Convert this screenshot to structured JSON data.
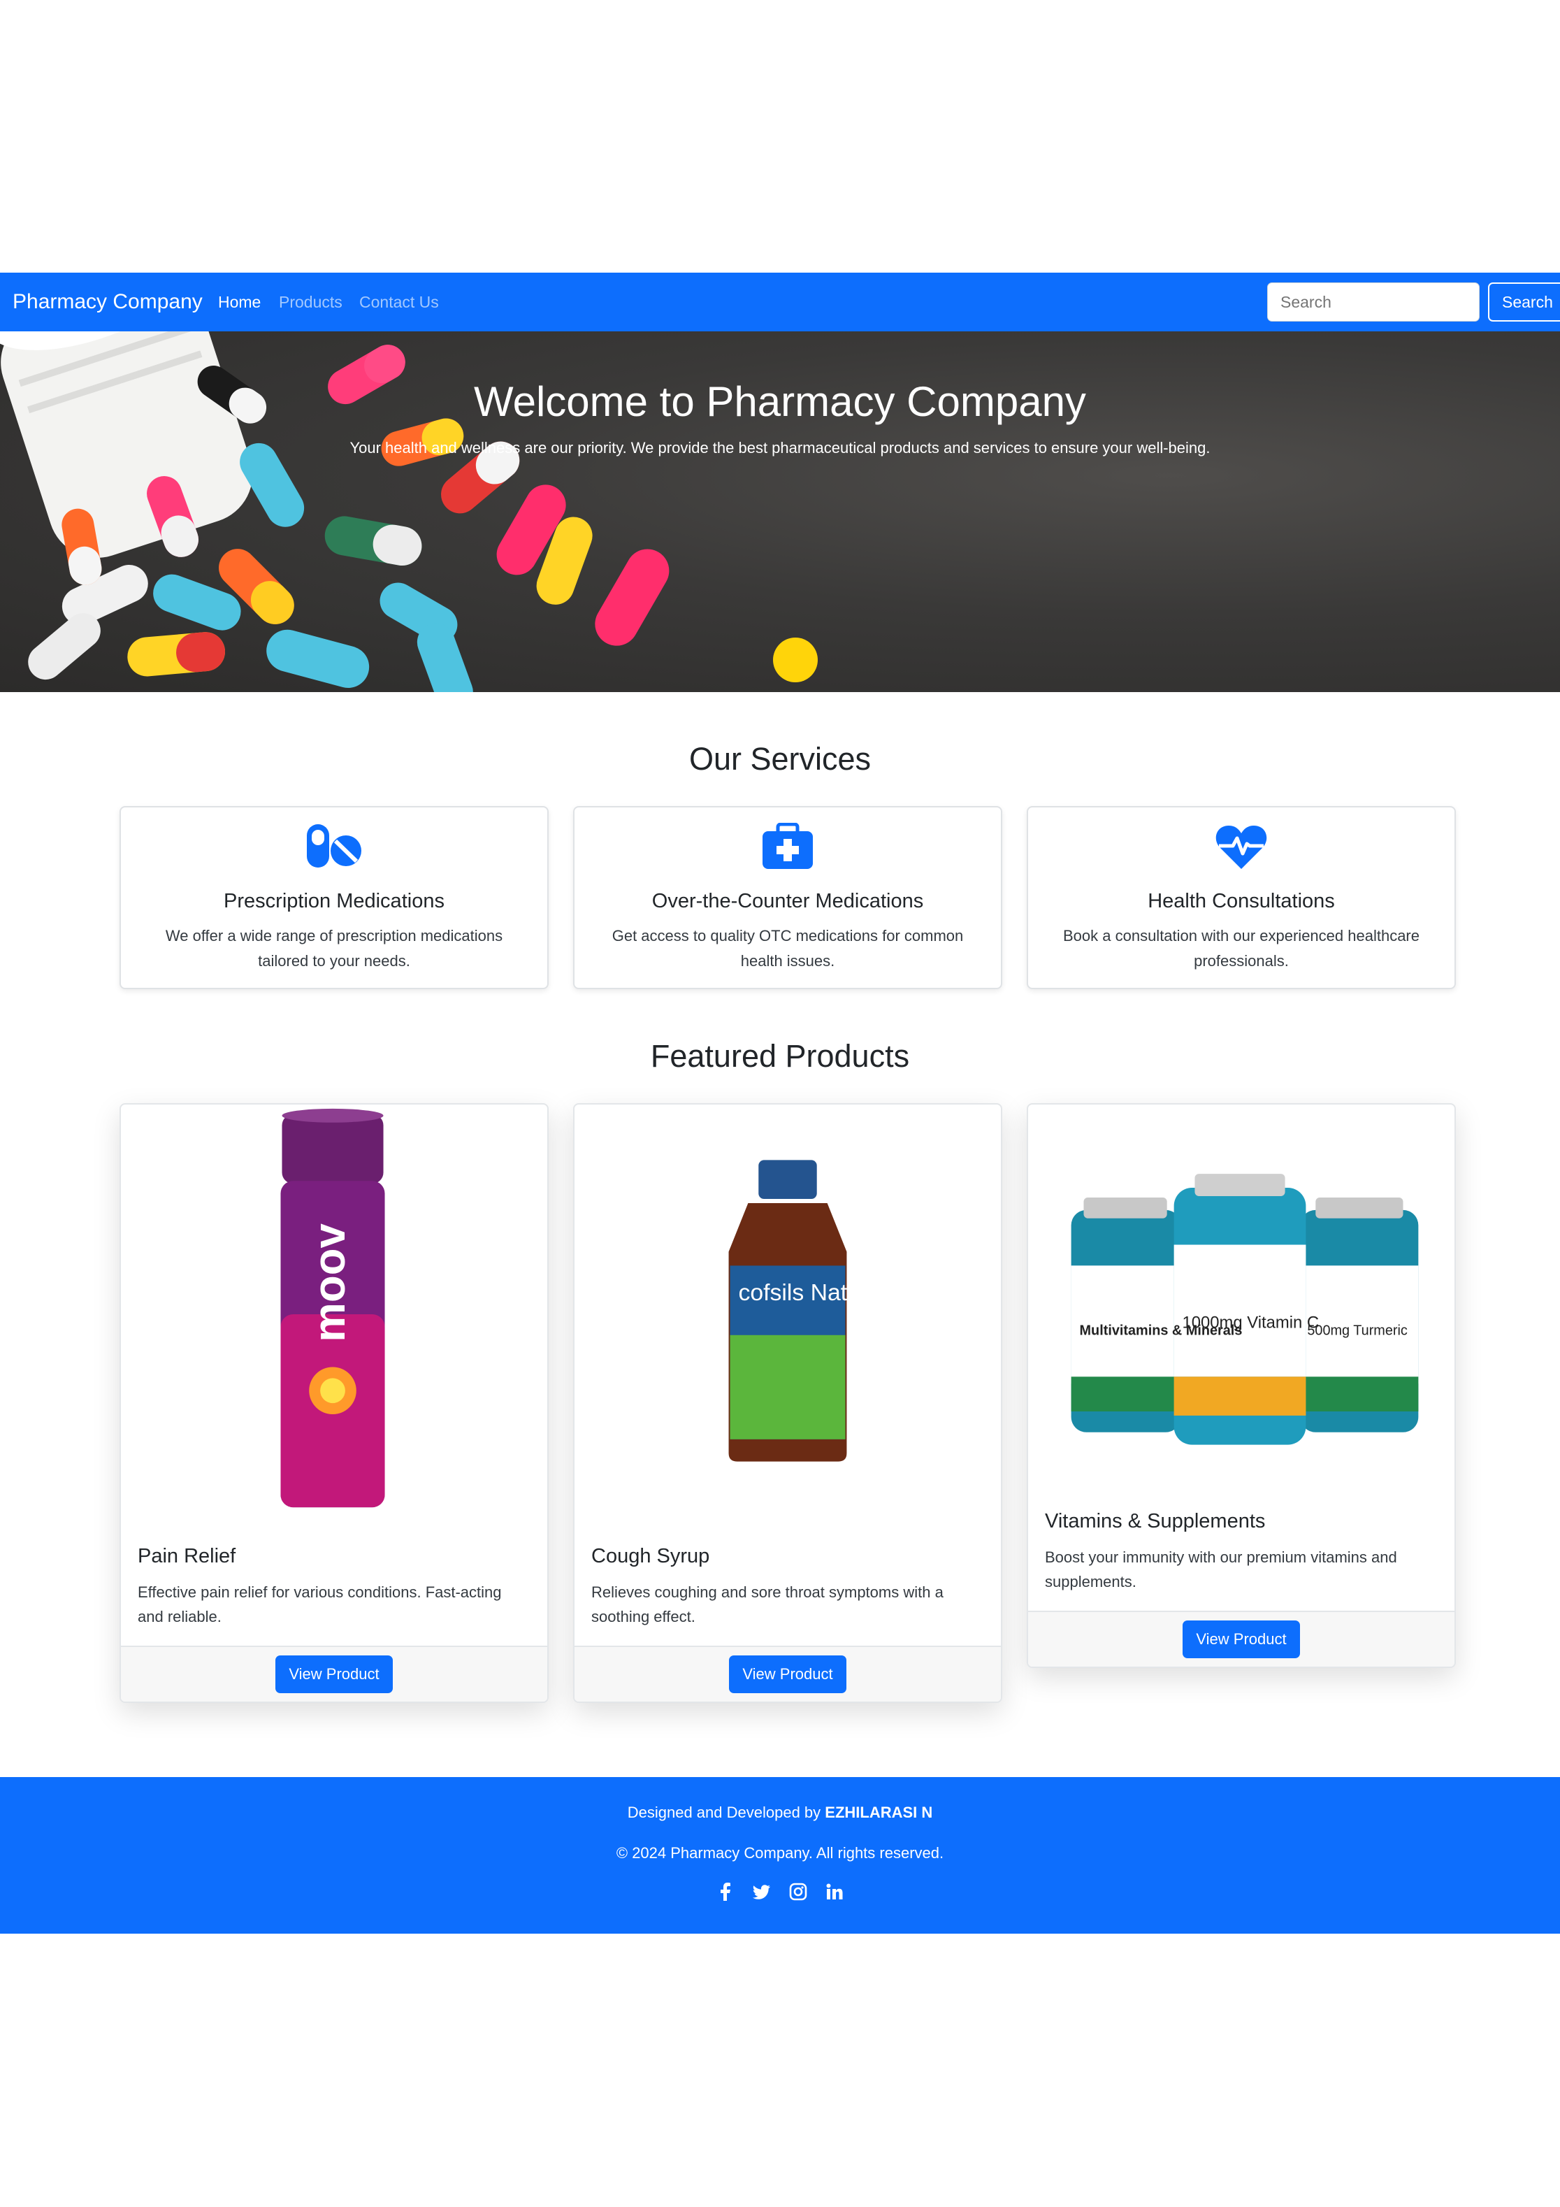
{
  "navbar": {
    "brand": "Pharmacy Company",
    "links": [
      "Home",
      "Products",
      "Contact Us"
    ],
    "search_placeholder": "Search",
    "search_button": "Search"
  },
  "hero": {
    "title": "Welcome to Pharmacy Company",
    "subtitle": "Your health and wellness are our priority. We provide the best pharmaceutical products and services to ensure your well-being."
  },
  "services": {
    "title": "Our Services",
    "items": [
      {
        "icon": "pills-icon",
        "title": "Prescription Medications",
        "text": "We offer a wide range of prescription medications tailored to your needs."
      },
      {
        "icon": "medkit-icon",
        "title": "Over-the-Counter Medications",
        "text": "Get access to quality OTC medications for common health issues."
      },
      {
        "icon": "heartbeat-icon",
        "title": "Health Consultations",
        "text": "Book a consultation with our experienced healthcare professionals."
      }
    ]
  },
  "products": {
    "title": "Featured Products",
    "items": [
      {
        "title": "Pain Relief",
        "text": "Effective pain relief for various conditions. Fast-acting and reliable.",
        "button": "View Product",
        "image_text": "moov"
      },
      {
        "title": "Cough Syrup",
        "text": "Relieves coughing and sore throat symptoms with a soothing effect.",
        "button": "View Product",
        "image_text": "cofsils Naturals"
      },
      {
        "title": "Vitamins & Supplements",
        "text": "Boost your immunity with our premium vitamins and supplements.",
        "button": "View Product",
        "image_labels": [
          "Multivitamins & Minerals",
          "1000mg Vitamin C",
          "500mg Turmeric"
        ]
      }
    ]
  },
  "footer": {
    "designed_prefix": "Designed and Developed by ",
    "designer": "EZHILARASI N",
    "copyright": "© 2024 Pharmacy Company. All rights reserved.",
    "social": [
      "facebook-icon",
      "twitter-icon",
      "instagram-icon",
      "linkedin-icon"
    ]
  },
  "colors": {
    "primary": "#0d6efd",
    "text": "#212529",
    "background": "#ffffff"
  }
}
